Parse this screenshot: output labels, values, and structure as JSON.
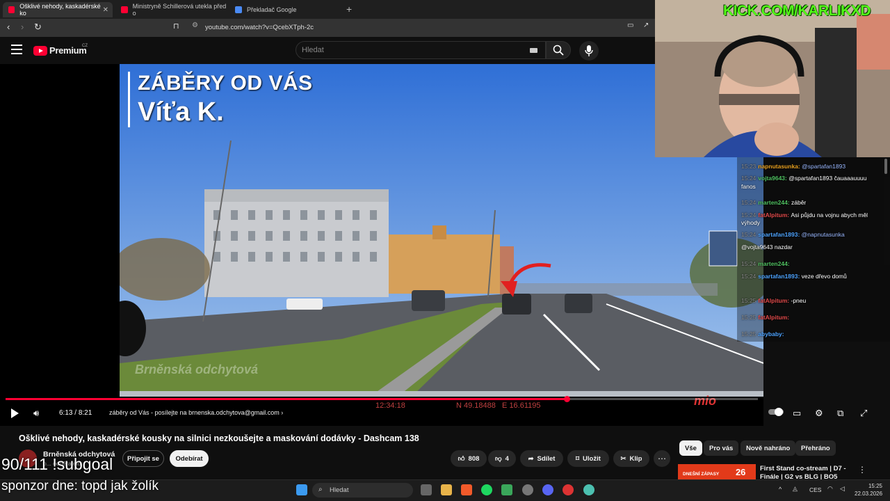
{
  "browser": {
    "tabs": [
      {
        "label": "Ošklivé nehody, kaskadérské ko",
        "active": true
      },
      {
        "label": "Ministryně Schillerová utekla před o"
      },
      {
        "label": "Překladač Google"
      }
    ],
    "url": "youtube.com/watch?v=QcebXTph-2c"
  },
  "youtube": {
    "logo_text": "Premium",
    "region": "CZ",
    "search_placeholder": "Hledat"
  },
  "video": {
    "overlay_title": "ZÁBĚRY OD VÁS",
    "overlay_author": "Víťa K.",
    "watermark": "Brněnská odchytová",
    "gps_time": "12:34:18",
    "gps_coords": "N 49.18488   E 16.61195",
    "camera_brand": "mio",
    "progress": 0.746,
    "time_current": "6:13",
    "time_sep": " / ",
    "time_total": "8:21",
    "chapter": "záběry od Vás - posílejte na brnenska.odchytova@gmail.com",
    "chapter_chevron": "›",
    "title": "Ošklivé nehody, kaskadérské kousky na silnici nezkoušejte a maskování dodávky - Dashcam 138"
  },
  "channel": {
    "name": "Brněnská odchytová",
    "subs": "o... odběratelů",
    "join_label": "Připojit se",
    "subscribe_label": "Odebírat"
  },
  "actions": {
    "likes": "808",
    "dislikes": "4",
    "share": "Sdílet",
    "save": "Uložit",
    "clip": "Klip",
    "more": "⋯"
  },
  "chips": [
    "Vše",
    "Pro vás",
    "Nově nahráno",
    "Přehráno"
  ],
  "recommended": {
    "thumb_text": "DNEŠNÍ ZÁPASY",
    "thumb_number": "26",
    "title": "First Stand co-stream | D7 - Finále | G2 vs BLG | BO5"
  },
  "stream_overlay": {
    "kick": "KICK.COM/KARLIKXD",
    "goal": "90/111 !subgoal",
    "sponsor": "sponzor dne: topd jak žolík"
  },
  "chat": [
    {
      "ts": "15:23",
      "user": "napnutasunka",
      "ucls": "u1",
      "msg": "@spartafan1893",
      "mention": true
    },
    {
      "ts": "15:24",
      "user": "vojta9643",
      "ucls": "u2",
      "msg": "@spartafan1893 čauaaauuuu",
      "mention": false
    },
    {
      "ts": "",
      "user": "",
      "ucls": "",
      "msg": "fanos",
      "mention": false
    },
    {
      "ts": "15:24",
      "user": "marten244",
      "ucls": "u2",
      "msg": "záběr",
      "mention": false
    },
    {
      "ts": "15:24",
      "user": "fatAlpitum",
      "ucls": "u4",
      "msg": "Asi půjdu na vojnu abych měl",
      "mention": false
    },
    {
      "ts": "",
      "user": "",
      "ucls": "",
      "msg": "výhody",
      "mention": false
    },
    {
      "ts": "15:24",
      "user": "spartafan1893",
      "ucls": "u3",
      "msg": "@napnutasunka",
      "mention": true
    },
    {
      "ts": "",
      "user": "",
      "ucls": "",
      "msg": "@vojta9643 nazdar",
      "mention": false
    },
    {
      "ts": "15:24",
      "user": "marten244",
      "ucls": "u2",
      "msg": "",
      "mention": false
    },
    {
      "ts": "15:24",
      "user": "spartafan1893",
      "ucls": "u3",
      "msg": "veze dřevo domů",
      "mention": false
    },
    {
      "ts": "15:25",
      "user": "fatAlpitum",
      "ucls": "u4",
      "msg": "-pneu",
      "mention": false
    },
    {
      "ts": "15:25",
      "user": "fatAlpitum",
      "ucls": "u4",
      "msg": "",
      "mention": false
    },
    {
      "ts": "15:25",
      "user": "abybaby",
      "ucls": "u3",
      "msg": "",
      "mention": false
    }
  ],
  "taskbar": {
    "search": "Hledat",
    "lang": "CES",
    "time": "15:25",
    "date": "22.03.2026"
  },
  "colors": {
    "accent": "#ff0033",
    "kick": "#53fc18"
  }
}
